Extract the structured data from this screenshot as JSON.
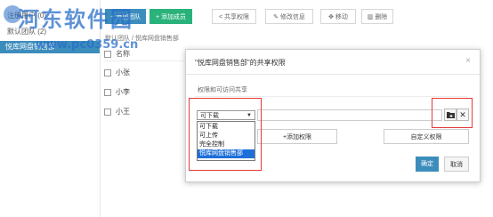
{
  "sidebar": {
    "items": [
      {
        "label": "注册用户 (0)"
      },
      {
        "label": "默认团队 (2)"
      },
      {
        "label": "悦库网盘销售部"
      }
    ]
  },
  "toolbar": {
    "add_team": "+ 添加团队",
    "add_member": "+ 添加成员",
    "share_perm": "共享权限",
    "edit_info": "修改信息",
    "move": "移动",
    "delete": "删除"
  },
  "breadcrumb": "默认团队 / 悦库网盘销售部",
  "table": {
    "header": "名称",
    "rows": [
      "小张",
      "小李",
      "小王"
    ]
  },
  "watermark": {
    "line1": "河东软件园",
    "line2": "www.pc0359.cn"
  },
  "dialog": {
    "title": "\"悦库网盘销售部\"的共享权限",
    "close": "×",
    "subtitle": "权限和可访问共享",
    "select_value": "可下载",
    "options": [
      "可下载",
      "可上传",
      "完全控制",
      "悦库网盘销售部"
    ],
    "selected_option_index": 3,
    "add_perm": "+添加权限",
    "custom_perm": "自定义权限",
    "ok": "确定",
    "cancel": "取消"
  },
  "colors": {
    "primary": "#3c8dbc",
    "green": "#2ab27b",
    "highlight_red": "#e63a3a"
  }
}
